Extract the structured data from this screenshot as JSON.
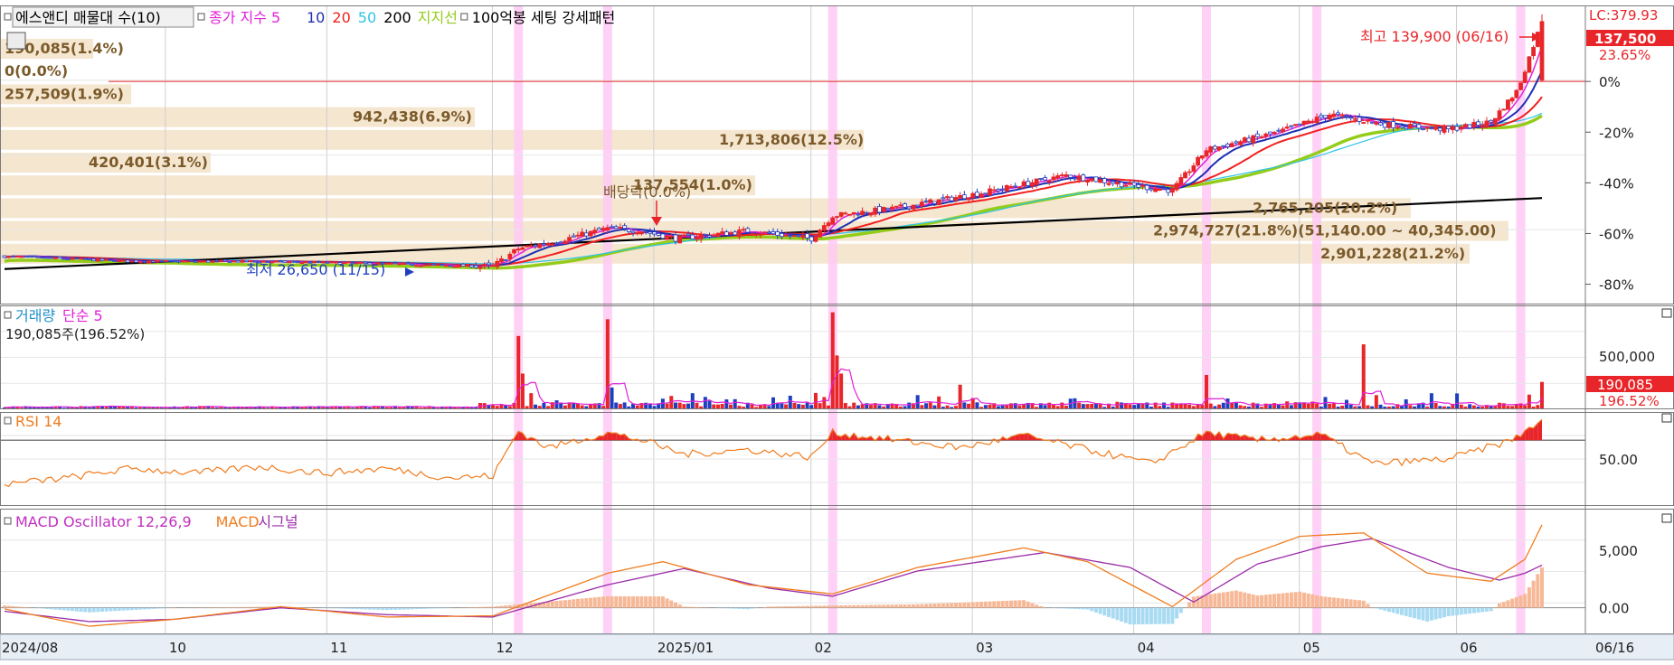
{
  "colors": {
    "up": "#e8262a",
    "down": "#1f3fbf",
    "ma5": "#e020d8",
    "ma10": "#1e2fb4",
    "ma20": "#f21f1f",
    "ma50": "#2ec4e6",
    "ma200": "#000000",
    "support": "#94cc1a",
    "highlight": "#ffc9f5",
    "band": "#f5e6d0",
    "volMa": "#e020d8",
    "rsi": "#f07c1e",
    "macd": "#f07c1e",
    "signal": "#9a2aa8",
    "oscPos": "#f6b896",
    "oscNeg": "#a8daf2"
  },
  "legend": {
    "main": [
      {
        "text": "에스앤디 매물대 수(10)",
        "color": "#000000"
      },
      {
        "text": "종가 지수 5",
        "color": "#e020d8"
      },
      {
        "text": "10",
        "color": "#1e2fb4"
      },
      {
        "text": "20",
        "color": "#f21f1f"
      },
      {
        "text": "50",
        "color": "#2ec4e6"
      },
      {
        "text": "200",
        "color": "#000000"
      },
      {
        "text": "지지선",
        "color": "#94cc1a"
      },
      {
        "text": "100억봉 세팅 강세패턴",
        "color": "#000000"
      }
    ],
    "volume": [
      {
        "text": "거래량",
        "color": "#1e8fc8"
      },
      {
        "text": "단순 5",
        "color": "#e020d8"
      }
    ],
    "volume_value": "190,085주(196.52%)",
    "rsi": [
      {
        "text": "RSI 14",
        "color": "#f07c1e"
      }
    ],
    "macd": [
      {
        "text": "MACD Oscillator 12,26,9",
        "color": "#c030c0"
      },
      {
        "text": "MACD",
        "color": "#f07c1e"
      },
      {
        "text": "시그널",
        "color": "#9a2aa8"
      }
    ]
  },
  "right_axis": {
    "lc_label": "LC:379.93",
    "price_tag": "137,500",
    "pct_tag": "23.65%",
    "pct_ticks": [
      {
        "label": "0%",
        "v": 0
      },
      {
        "label": "-20%",
        "v": -20
      },
      {
        "label": "-40%",
        "v": -40
      },
      {
        "label": "-60%",
        "v": -60
      },
      {
        "label": "-80%",
        "v": -80
      }
    ],
    "vol_tick": "500,000",
    "vol_tag": "190,085",
    "vol_pct_tag": "196.52%",
    "rsi_tick": "50.00",
    "macd_ticks": [
      "5,000",
      "0.00"
    ]
  },
  "annotations": {
    "high": "최고 139,900 (06/16)",
    "low": "최저 26,650 (11/15)",
    "dividend": "배당락(0.0%)"
  },
  "x_axis": {
    "labels": [
      {
        "label": "2024/08",
        "i": 0
      },
      {
        "label": "10",
        "i": 40
      },
      {
        "label": "11",
        "i": 78
      },
      {
        "label": "12",
        "i": 117
      },
      {
        "label": "2025/01",
        "i": 155
      },
      {
        "label": "02",
        "i": 192
      },
      {
        "label": "03",
        "i": 230
      },
      {
        "label": "04",
        "i": 268
      },
      {
        "label": "05",
        "i": 307
      },
      {
        "label": "06",
        "i": 344
      }
    ],
    "end_label": "06/16"
  },
  "chart_data": {
    "type": "candlestick",
    "bars": 363,
    "pct_axis_ylim": [
      -88,
      30
    ],
    "highlight_bars": [
      121,
      142,
      195,
      283,
      309,
      357
    ],
    "volume_profile": [
      {
        "label": "190,085(1.4%)",
        "pct": 1.4
      },
      {
        "label": "0(0.0%)",
        "pct": 0.0
      },
      {
        "label": "257,509(1.9%)",
        "pct": 1.9
      },
      {
        "label": "942,438(6.9%)",
        "pct": 6.9
      },
      {
        "label": "1,713,806(12.5%)",
        "pct": 12.5
      },
      {
        "label": "420,401(3.1%)",
        "pct": 3.1
      },
      {
        "label": "137,554(1.0%)",
        "pct": 1.0
      },
      {
        "label": "2,765,205(20.2%)",
        "pct": 20.2
      },
      {
        "label": "2,974,727(21.8%)(51,140.00 ~ 40,345.00)",
        "pct": 21.8
      },
      {
        "label": "2,901,228(21.2%)",
        "pct": 21.2
      }
    ],
    "close_pct_anchors": [
      [
        0,
        -69
      ],
      [
        30,
        -71
      ],
      [
        60,
        -71
      ],
      [
        90,
        -72
      ],
      [
        115,
        -73
      ],
      [
        121,
        -66
      ],
      [
        130,
        -63
      ],
      [
        142,
        -58
      ],
      [
        150,
        -59
      ],
      [
        158,
        -62
      ],
      [
        175,
        -59
      ],
      [
        190,
        -62
      ],
      [
        195,
        -53
      ],
      [
        210,
        -50
      ],
      [
        230,
        -44
      ],
      [
        250,
        -37
      ],
      [
        265,
        -41
      ],
      [
        275,
        -43
      ],
      [
        283,
        -27
      ],
      [
        300,
        -20
      ],
      [
        312,
        -13
      ],
      [
        325,
        -17
      ],
      [
        340,
        -19
      ],
      [
        350,
        -16
      ],
      [
        356,
        -4
      ],
      [
        357,
        0
      ],
      [
        362,
        23.65
      ]
    ],
    "ma200_pct_endpoints": [
      [
        0,
        -74
      ],
      [
        362,
        -46
      ]
    ],
    "volume": {
      "scale_max": 720000,
      "baseline": 10000,
      "spikes": [
        {
          "i": 121,
          "v": 520000
        },
        {
          "i": 122,
          "v": 250000
        },
        {
          "i": 142,
          "v": 640000
        },
        {
          "i": 143,
          "v": 150000
        },
        {
          "i": 195,
          "v": 690000
        },
        {
          "i": 196,
          "v": 380000
        },
        {
          "i": 197,
          "v": 250000
        },
        {
          "i": 225,
          "v": 170000
        },
        {
          "i": 283,
          "v": 240000
        },
        {
          "i": 320,
          "v": 460000
        },
        {
          "i": 362,
          "v": 190085
        }
      ]
    },
    "rsi": {
      "ylim": [
        0,
        100
      ],
      "level": 70,
      "anchors": [
        [
          0,
          23
        ],
        [
          15,
          30
        ],
        [
          30,
          40
        ],
        [
          45,
          35
        ],
        [
          60,
          42
        ],
        [
          75,
          35
        ],
        [
          90,
          40
        ],
        [
          105,
          30
        ],
        [
          115,
          32
        ],
        [
          121,
          80
        ],
        [
          128,
          62
        ],
        [
          142,
          78
        ],
        [
          150,
          70
        ],
        [
          160,
          55
        ],
        [
          175,
          60
        ],
        [
          190,
          52
        ],
        [
          195,
          78
        ],
        [
          210,
          70
        ],
        [
          225,
          62
        ],
        [
          240,
          75
        ],
        [
          255,
          60
        ],
        [
          270,
          45
        ],
        [
          283,
          78
        ],
        [
          295,
          70
        ],
        [
          310,
          76
        ],
        [
          322,
          45
        ],
        [
          340,
          50
        ],
        [
          355,
          70
        ],
        [
          362,
          92
        ]
      ]
    },
    "macd": {
      "ylim": [
        -2300,
        8600
      ],
      "macd_anchors": [
        [
          0,
          -100
        ],
        [
          20,
          -1600
        ],
        [
          40,
          -1000
        ],
        [
          65,
          100
        ],
        [
          90,
          -800
        ],
        [
          115,
          -700
        ],
        [
          142,
          3000
        ],
        [
          155,
          4000
        ],
        [
          175,
          2000
        ],
        [
          195,
          1200
        ],
        [
          215,
          3500
        ],
        [
          240,
          5200
        ],
        [
          255,
          4000
        ],
        [
          275,
          100
        ],
        [
          290,
          4200
        ],
        [
          305,
          6200
        ],
        [
          320,
          6500
        ],
        [
          335,
          3000
        ],
        [
          350,
          2300
        ],
        [
          358,
          4200
        ],
        [
          362,
          7200
        ]
      ],
      "signal_anchors": [
        [
          0,
          -300
        ],
        [
          20,
          -1200
        ],
        [
          40,
          -1000
        ],
        [
          65,
          0
        ],
        [
          90,
          -600
        ],
        [
          115,
          -800
        ],
        [
          142,
          2000
        ],
        [
          160,
          3400
        ],
        [
          180,
          1700
        ],
        [
          195,
          1000
        ],
        [
          215,
          3200
        ],
        [
          245,
          4800
        ],
        [
          265,
          3500
        ],
        [
          280,
          500
        ],
        [
          295,
          3800
        ],
        [
          310,
          5300
        ],
        [
          322,
          6000
        ],
        [
          340,
          3500
        ],
        [
          352,
          2400
        ],
        [
          358,
          3000
        ],
        [
          362,
          3700
        ]
      ]
    }
  }
}
